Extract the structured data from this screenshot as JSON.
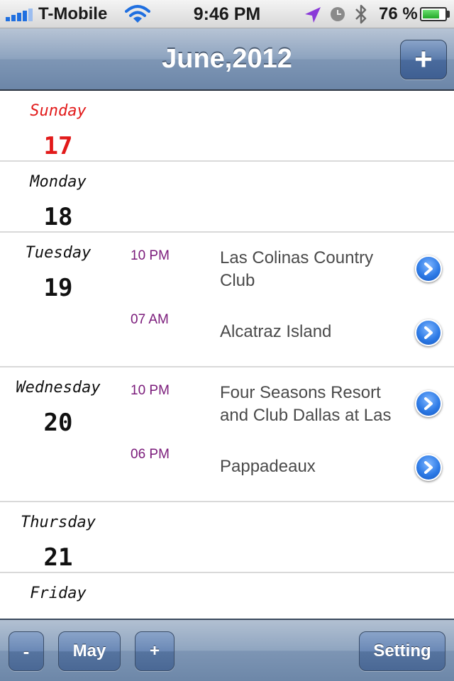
{
  "status_bar": {
    "carrier": "T-Mobile",
    "time": "9:46 PM",
    "battery_percent": "76 %",
    "battery_level": 0.76,
    "icons": [
      "signal-bars-icon",
      "wifi-icon",
      "location-arrow-icon",
      "alarm-clock-icon",
      "bluetooth-icon",
      "battery-icon"
    ]
  },
  "nav": {
    "title": "June,2012",
    "add_label": "+"
  },
  "days": [
    {
      "name": "Sunday",
      "number": "17",
      "events": []
    },
    {
      "name": "Monday",
      "number": "18",
      "events": []
    },
    {
      "name": "Tuesday",
      "number": "19",
      "events": [
        {
          "time": "10 PM",
          "title": "Las Colinas Country Club"
        },
        {
          "time": "07 AM",
          "title": "Alcatraz Island"
        }
      ]
    },
    {
      "name": "Wednesday",
      "number": "20",
      "events": [
        {
          "time": "10 PM",
          "title": "Four Seasons Resort and Club Dallas at Las"
        },
        {
          "time": "06 PM",
          "title": "Pappadeaux"
        }
      ]
    },
    {
      "name": "Thursday",
      "number": "21",
      "events": []
    },
    {
      "name": "Friday",
      "number": "",
      "events": []
    }
  ],
  "toolbar": {
    "minus_label": "-",
    "month_label": "May",
    "plus_label": "+",
    "setting_label": "Setting"
  },
  "colors": {
    "sunday": "#e21a1a",
    "event_time": "#7a1a7a",
    "event_title": "#4a4a4a"
  }
}
